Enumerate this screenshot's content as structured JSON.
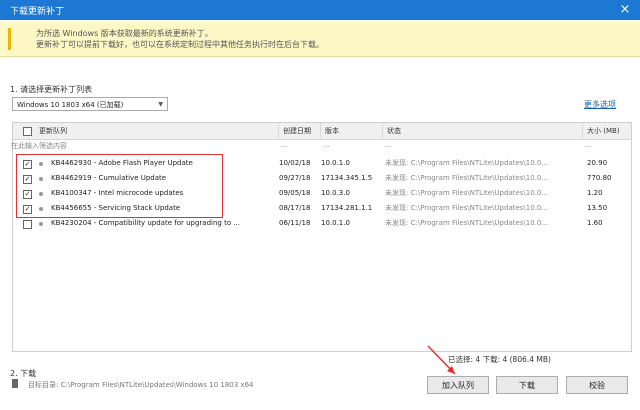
{
  "window": {
    "title": "下载更新补丁",
    "close_glyph": "×"
  },
  "info": {
    "line1": "为所选 Windows 版本获取最新的系统更新补丁。",
    "line2": "更新补丁可以提前下载好，也可以在系统定制过程中其他任务执行时在后台下载。"
  },
  "section1_label": "1. 请选择更新补丁列表",
  "dropdown_value": "Windows 10 1803 x64 (已加载)",
  "more_options": "更多选项",
  "table": {
    "headers": [
      "更新队列",
      "创建日期",
      "版本",
      "状态",
      "大小 (MB)"
    ],
    "filter_placeholder": "在此输入筛选内容",
    "filter_dots": [
      "...",
      "...",
      "...",
      "..."
    ],
    "rows": [
      {
        "checked": true,
        "name": "KB4462930 - Adobe Flash Player Update",
        "date": "10/02/18",
        "version": "10.0.1.0",
        "status": "未发现: C:\\Program Files\\NTLite\\Updates\\10.0...",
        "size": "20.90"
      },
      {
        "checked": true,
        "name": "KB4462919 - Cumulative Update",
        "date": "09/27/18",
        "version": "17134.345.1.5",
        "status": "未发现: C:\\Program Files\\NTLite\\Updates\\10.0...",
        "size": "770.80"
      },
      {
        "checked": true,
        "name": "KB4100347 - Intel microcode updates",
        "date": "09/05/18",
        "version": "10.0.3.0",
        "status": "未发现: C:\\Program Files\\NTLite\\Updates\\10.0...",
        "size": "1.20"
      },
      {
        "checked": true,
        "name": "KB4456655 - Servicing Stack Update",
        "date": "08/17/18",
        "version": "17134.281.1.1",
        "status": "未发现: C:\\Program Files\\NTLite\\Updates\\10.0...",
        "size": "13.50"
      },
      {
        "checked": false,
        "name": "KB4230204 - Compatibility update for upgrading to ...",
        "date": "06/11/18",
        "version": "10.0.1.0",
        "status": "未发现: C:\\Program Files\\NTLite\\Updates\\10.0...",
        "size": "1.60"
      }
    ]
  },
  "summary": "已选择: 4   下载: 4 (806.4 MB)",
  "section2_label": "2. 下载",
  "target_label": "目标目录: C:\\Program Files\\NTLite\\Updates\\Windows 10 1803 x64",
  "buttons": {
    "enqueue": "加入队列",
    "download": "下载",
    "verify": "校验"
  },
  "colors": {
    "titlebar": "#1c78d3",
    "highlight": "#e03030",
    "link": "#1a5fb4"
  }
}
